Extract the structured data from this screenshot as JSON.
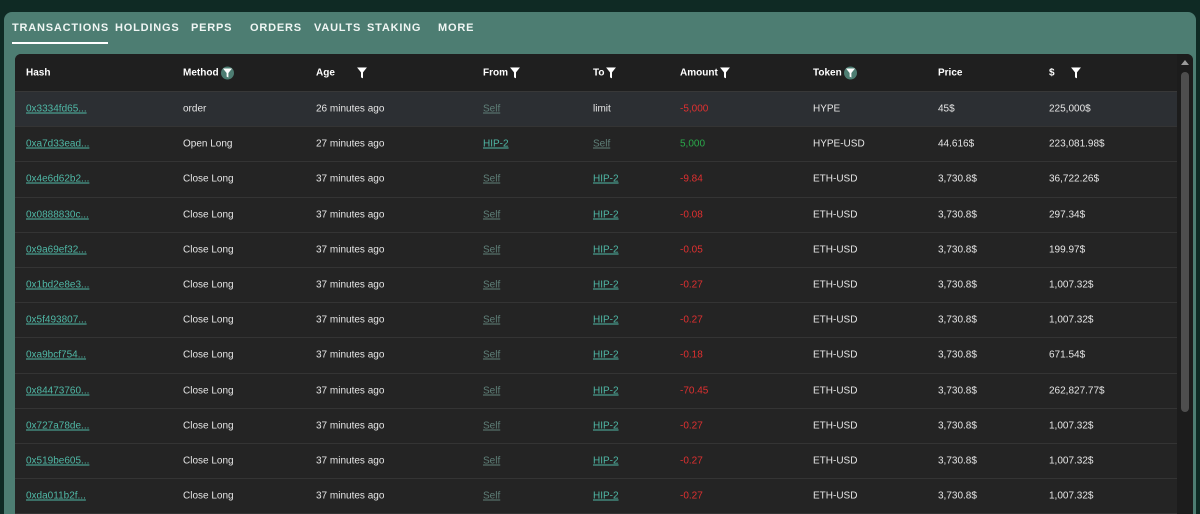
{
  "tabs": [
    "TRANSACTIONS",
    "HOLDINGS",
    "PERPS",
    "ORDERS",
    "VAULTS",
    "STAKING",
    "MORE"
  ],
  "active_tab": "TRANSACTIONS",
  "columns": [
    "Hash",
    "Method",
    "Age",
    "From",
    "To",
    "Amount",
    "Token",
    "Price",
    "$"
  ],
  "rows": [
    {
      "hash": "0x3334fd65...",
      "method": "order",
      "age": "26 minutes ago",
      "from": "Self",
      "to": "limit",
      "amount": "-5,000",
      "token": "HYPE",
      "price": "45$",
      "usd": "225,000$"
    },
    {
      "hash": "0xa7d33ead...",
      "method": "Open Long",
      "age": "27 minutes ago",
      "from": "HIP-2",
      "to": "Self",
      "amount": "5,000",
      "token": "HYPE-USD",
      "price": "44.616$",
      "usd": "223,081.98$"
    },
    {
      "hash": "0x4e6d62b2...",
      "method": "Close Long",
      "age": "37 minutes ago",
      "from": "Self",
      "to": "HIP-2",
      "amount": "-9.84",
      "token": "ETH-USD",
      "price": "3,730.8$",
      "usd": "36,722.26$"
    },
    {
      "hash": "0x0888830c...",
      "method": "Close Long",
      "age": "37 minutes ago",
      "from": "Self",
      "to": "HIP-2",
      "amount": "-0.08",
      "token": "ETH-USD",
      "price": "3,730.8$",
      "usd": "297.34$"
    },
    {
      "hash": "0x9a69ef32...",
      "method": "Close Long",
      "age": "37 minutes ago",
      "from": "Self",
      "to": "HIP-2",
      "amount": "-0.05",
      "token": "ETH-USD",
      "price": "3,730.8$",
      "usd": "199.97$"
    },
    {
      "hash": "0x1bd2e8e3...",
      "method": "Close Long",
      "age": "37 minutes ago",
      "from": "Self",
      "to": "HIP-2",
      "amount": "-0.27",
      "token": "ETH-USD",
      "price": "3,730.8$",
      "usd": "1,007.32$"
    },
    {
      "hash": "0x5f493807...",
      "method": "Close Long",
      "age": "37 minutes ago",
      "from": "Self",
      "to": "HIP-2",
      "amount": "-0.27",
      "token": "ETH-USD",
      "price": "3,730.8$",
      "usd": "1,007.32$"
    },
    {
      "hash": "0xa9bcf754...",
      "method": "Close Long",
      "age": "37 minutes ago",
      "from": "Self",
      "to": "HIP-2",
      "amount": "-0.18",
      "token": "ETH-USD",
      "price": "3,730.8$",
      "usd": "671.54$"
    },
    {
      "hash": "0x84473760...",
      "method": "Close Long",
      "age": "37 minutes ago",
      "from": "Self",
      "to": "HIP-2",
      "amount": "-70.45",
      "token": "ETH-USD",
      "price": "3,730.8$",
      "usd": "262,827.77$"
    },
    {
      "hash": "0x727a78de...",
      "method": "Close Long",
      "age": "37 minutes ago",
      "from": "Self",
      "to": "HIP-2",
      "amount": "-0.27",
      "token": "ETH-USD",
      "price": "3,730.8$",
      "usd": "1,007.32$"
    },
    {
      "hash": "0x519be605...",
      "method": "Close Long",
      "age": "37 minutes ago",
      "from": "Self",
      "to": "HIP-2",
      "amount": "-0.27",
      "token": "ETH-USD",
      "price": "3,730.8$",
      "usd": "1,007.32$"
    },
    {
      "hash": "0xda011b2f...",
      "method": "Close Long",
      "age": "37 minutes ago",
      "from": "Self",
      "to": "HIP-2",
      "amount": "-0.27",
      "token": "ETH-USD",
      "price": "3,730.8$",
      "usd": "1,007.32$"
    }
  ],
  "colors": {
    "background": "#0f2a24",
    "panel": "#4d7d72",
    "table": "#242424",
    "link": "#4fb8a6",
    "negative": "#e03030",
    "positive": "#2aa84a"
  },
  "icons": {
    "filter": "filter-icon"
  }
}
